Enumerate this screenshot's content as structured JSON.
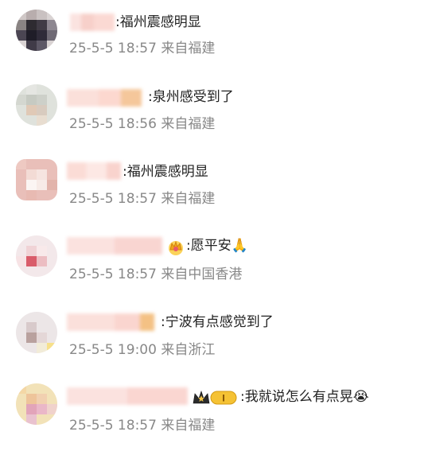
{
  "comments": [
    {
      "text": ":福州震感明显",
      "time": "25-5-5 18:57",
      "location": "来自福建"
    },
    {
      "text": ":泉州感受到了",
      "time": "25-5-5 18:56",
      "location": "来自福建"
    },
    {
      "text": ":福州震感明显",
      "time": "25-5-5 18:57",
      "location": "来自福建"
    },
    {
      "text": ":愿平安🙏",
      "time": "25-5-5 18:57",
      "location": "来自中国香港"
    },
    {
      "text": ":宁波有点感觉到了",
      "time": "25-5-5 19:00",
      "location": "来自浙江"
    },
    {
      "text": ":我就说怎么有点晃😭",
      "time": "25-5-5 18:57",
      "location": "来自福建"
    }
  ],
  "icons": {
    "avatar": "blurred-avatar",
    "crown_badge": "crown-badge-icon",
    "level_badge": "level-badge-icon",
    "emoji_pray": "pray-emoji",
    "emoji_cry": "cry-emoji"
  },
  "badges": {
    "level_text": "I"
  },
  "colors": {
    "text": "#222222",
    "meta": "#888888",
    "badge_gold": "#f0b429"
  }
}
